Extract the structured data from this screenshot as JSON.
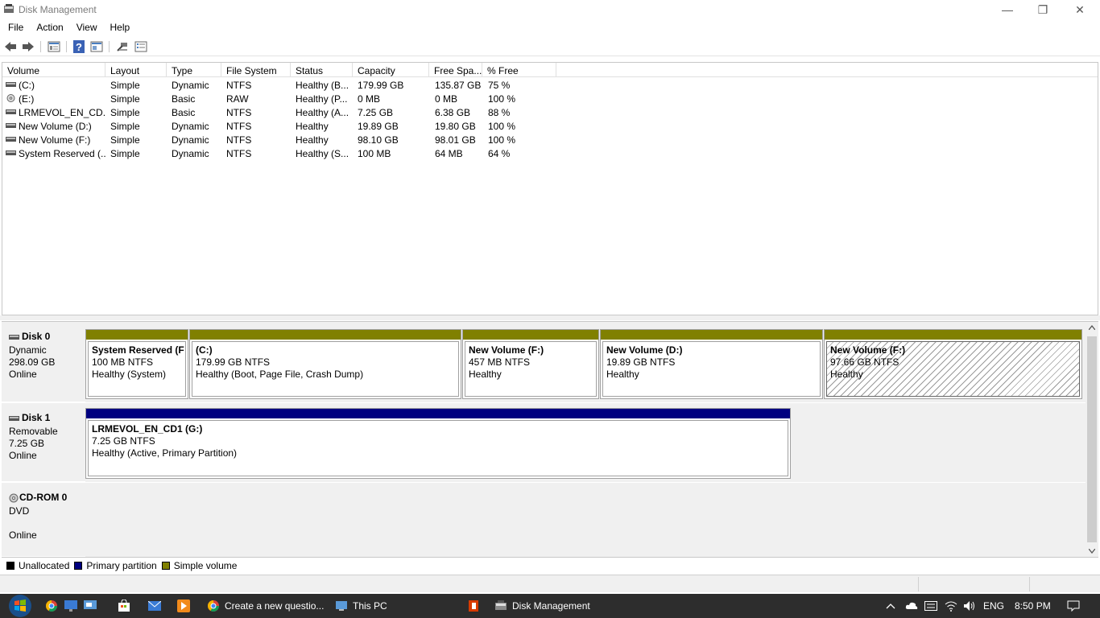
{
  "window": {
    "title": "Disk Management",
    "minimize_glyph": "—",
    "restore_glyph": "❐",
    "close_glyph": "✕"
  },
  "menu": [
    "File",
    "Action",
    "View",
    "Help"
  ],
  "toolbar": {
    "icons": [
      "back-icon",
      "forward-icon",
      "list-view-icon",
      "help-icon",
      "properties-icon",
      "connect-icon",
      "details-icon"
    ]
  },
  "columns": [
    "Volume",
    "Layout",
    "Type",
    "File System",
    "Status",
    "Capacity",
    "Free Spa...",
    "% Free"
  ],
  "volumes": [
    {
      "volume": "(C:)",
      "layout": "Simple",
      "type": "Dynamic",
      "fs": "NTFS",
      "status": "Healthy (B...",
      "capacity": "179.99 GB",
      "free": "135.87 GB",
      "pct": "75 %",
      "icon": "drive-icon"
    },
    {
      "volume": "(E:)",
      "layout": "Simple",
      "type": "Basic",
      "fs": "RAW",
      "status": "Healthy (P...",
      "capacity": "0 MB",
      "free": "0 MB",
      "pct": "100 %",
      "icon": "cdrom-icon"
    },
    {
      "volume": "LRMEVOL_EN_CD...",
      "layout": "Simple",
      "type": "Basic",
      "fs": "NTFS",
      "status": "Healthy (A...",
      "capacity": "7.25 GB",
      "free": "6.38 GB",
      "pct": "88 %",
      "icon": "drive-icon"
    },
    {
      "volume": "New Volume (D:)",
      "layout": "Simple",
      "type": "Dynamic",
      "fs": "NTFS",
      "status": "Healthy",
      "capacity": "19.89 GB",
      "free": "19.80 GB",
      "pct": "100 %",
      "icon": "drive-icon"
    },
    {
      "volume": "New Volume (F:)",
      "layout": "Simple",
      "type": "Dynamic",
      "fs": "NTFS",
      "status": "Healthy",
      "capacity": "98.10 GB",
      "free": "98.01 GB",
      "pct": "100 %",
      "icon": "drive-icon"
    },
    {
      "volume": "System Reserved (...",
      "layout": "Simple",
      "type": "Dynamic",
      "fs": "NTFS",
      "status": "Healthy (S...",
      "capacity": "100 MB",
      "free": "64 MB",
      "pct": "64 %",
      "icon": "drive-icon"
    }
  ],
  "disks": [
    {
      "name": "Disk 0",
      "kind": "Dynamic",
      "size": "298.09 GB",
      "state": "Online",
      "partitions": [
        {
          "name": "System Reserved  (F",
          "size": "100 MB NTFS",
          "status": "Healthy (System)",
          "bar": "#808000"
        },
        {
          "name": "(C:)",
          "size": "179.99 GB NTFS",
          "status": "Healthy (Boot, Page File, Crash Dump)",
          "bar": "#808000"
        },
        {
          "name": "New Volume  (F:)",
          "size": "457 MB NTFS",
          "status": "Healthy",
          "bar": "#808000"
        },
        {
          "name": "New Volume  (D:)",
          "size": "19.89 GB NTFS",
          "status": "Healthy",
          "bar": "#808000"
        },
        {
          "name": "New Volume  (F:)",
          "size": "97.66 GB NTFS",
          "status": "Healthy",
          "bar": "#808000",
          "selected": true
        }
      ]
    },
    {
      "name": "Disk 1",
      "kind": "Removable",
      "size": "7.25 GB",
      "state": "Online",
      "partitions": [
        {
          "name": "LRMEVOL_EN_CD1  (G:)",
          "size": "7.25 GB NTFS",
          "status": "Healthy (Active, Primary Partition)",
          "bar": "#000080"
        }
      ]
    },
    {
      "name": "CD-ROM 0",
      "kind": "DVD",
      "size": "",
      "state": "Online",
      "partitions": []
    }
  ],
  "legend": [
    {
      "label": "Unallocated",
      "color": "#000000"
    },
    {
      "label": "Primary partition",
      "color": "#000080"
    },
    {
      "label": "Simple volume",
      "color": "#808000"
    }
  ],
  "taskbar": {
    "apps": [
      {
        "label": "Create a new questio...",
        "icon": "chrome-icon"
      },
      {
        "label": "This PC",
        "icon": "this-pc-icon"
      },
      {
        "label": "",
        "icon": "office-icon"
      },
      {
        "label": "Disk Management",
        "icon": "disk-management-icon"
      }
    ],
    "tray": {
      "language": "ENG",
      "time": "8:50 PM"
    }
  }
}
